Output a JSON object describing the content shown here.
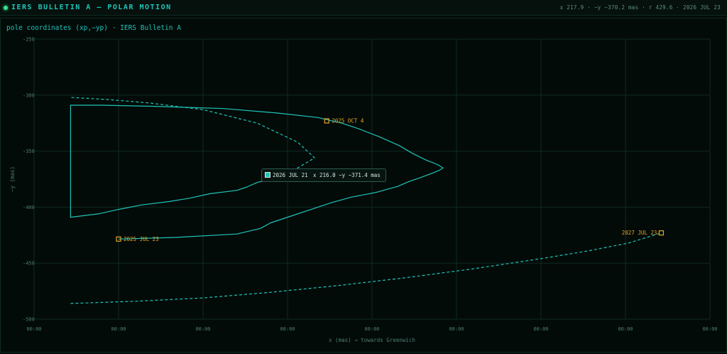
{
  "app": {
    "title": "IERS BULLETIN A — POLAR MOTION",
    "readout": "x 217.9 · −y −370.2 mas · r 429.6 · 2026 JUL 23"
  },
  "subtitle": "pole coordinates (xp,−yp) · IERS Bulletin A",
  "tooltip": {
    "date": "2026 JUL 21",
    "value": "x 216.0  −y −371.4 mas"
  },
  "colors": {
    "accent": "#1fc4b8",
    "annotation": "#e3a829",
    "grid": "#0f2a22",
    "tick": "#4e7d74"
  },
  "chart_data": {
    "type": "line",
    "xlabel": "x (mas) → towards Greenwich",
    "ylabel": "−y (mas)",
    "ylim": [
      -500,
      -250
    ],
    "yticks": [
      -250,
      -300,
      -350,
      -400,
      -450,
      -500
    ],
    "xticks": [
      "00:00",
      "00:00",
      "00:00",
      "00:00",
      "00:00",
      "00:00",
      "00:00",
      "00:00",
      "00:00"
    ],
    "grid": true,
    "series": [
      {
        "style": "solid",
        "points": [
          [
            125,
            -428.5
          ],
          [
            210,
            -427
          ],
          [
            300,
            -424
          ],
          [
            335,
            -419
          ],
          [
            350,
            -414
          ],
          [
            380,
            -408
          ],
          [
            410,
            -402
          ],
          [
            440,
            -396
          ],
          [
            470,
            -391
          ],
          [
            505,
            -387
          ],
          [
            538,
            -381.5
          ],
          [
            555,
            -377
          ],
          [
            570,
            -374
          ],
          [
            590,
            -369.5
          ],
          [
            600,
            -367
          ],
          [
            605,
            -365
          ],
          [
            597,
            -362
          ],
          [
            580,
            -358
          ],
          [
            560,
            -352
          ],
          [
            540,
            -345
          ],
          [
            510,
            -337
          ],
          [
            480,
            -330
          ],
          [
            455,
            -325
          ],
          [
            420,
            -320
          ],
          [
            360,
            -316
          ],
          [
            280,
            -312
          ],
          [
            180,
            -310
          ],
          [
            100,
            -309
          ],
          [
            54,
            -309
          ],
          [
            54,
            -409
          ],
          [
            95,
            -406
          ],
          [
            125,
            -402
          ],
          [
            160,
            -398
          ],
          [
            200,
            -395
          ],
          [
            230,
            -392
          ],
          [
            260,
            -388
          ],
          [
            300,
            -385
          ],
          [
            315,
            -382
          ],
          [
            330,
            -378
          ],
          [
            350,
            -375
          ],
          [
            362,
            -372
          ]
        ]
      },
      {
        "style": "dashed",
        "points": [
          [
            362,
            -372
          ],
          [
            390,
            -365
          ],
          [
            415,
            -356
          ],
          [
            390,
            -342
          ],
          [
            330,
            -325
          ],
          [
            250,
            -313
          ],
          [
            170,
            -307
          ],
          [
            110,
            -304
          ],
          [
            54,
            -302
          ]
        ]
      },
      {
        "style": "dashed",
        "points": [
          [
            54,
            -486
          ],
          [
            150,
            -484
          ],
          [
            250,
            -481
          ],
          [
            350,
            -476
          ],
          [
            450,
            -470
          ],
          [
            550,
            -463
          ],
          [
            650,
            -455
          ],
          [
            750,
            -446
          ],
          [
            820,
            -439
          ],
          [
            880,
            -432
          ],
          [
            928,
            -423
          ]
        ]
      }
    ],
    "annotations": [
      {
        "label": "2025 OCT 4",
        "x": 433,
        "y": -323
      },
      {
        "label": "2025 JUL 23",
        "x": 125,
        "y": -428.5
      },
      {
        "label": "2027 JUL 23",
        "x": 928,
        "y": -423
      }
    ]
  }
}
